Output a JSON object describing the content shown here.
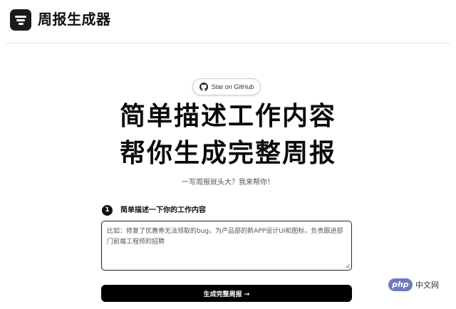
{
  "header": {
    "app_title": "周报生成器",
    "logo_icon": "list-filter-icon"
  },
  "github": {
    "label": "Star on GitHub",
    "icon": "github-icon"
  },
  "hero": {
    "line1": "简单描述工作内容",
    "line2": "帮你生成完整周报",
    "subtitle": "一写周报就头大？我来帮你！"
  },
  "step": {
    "number": "1",
    "label": "简单描述一下你的工作内容"
  },
  "input": {
    "placeholder": "比如：修复了优惠券无法领取的bug，为产品部的新APP设计UI和图标，负责跟进部门前端工程师的招聘",
    "value": ""
  },
  "generate": {
    "label": "生成完整周报 →"
  },
  "watermark": {
    "logo_text": "php",
    "text": "中文网"
  },
  "colors": {
    "primary": "#000000",
    "logo_bg": "#1b1b1b",
    "watermark": "#6f7bbd"
  }
}
